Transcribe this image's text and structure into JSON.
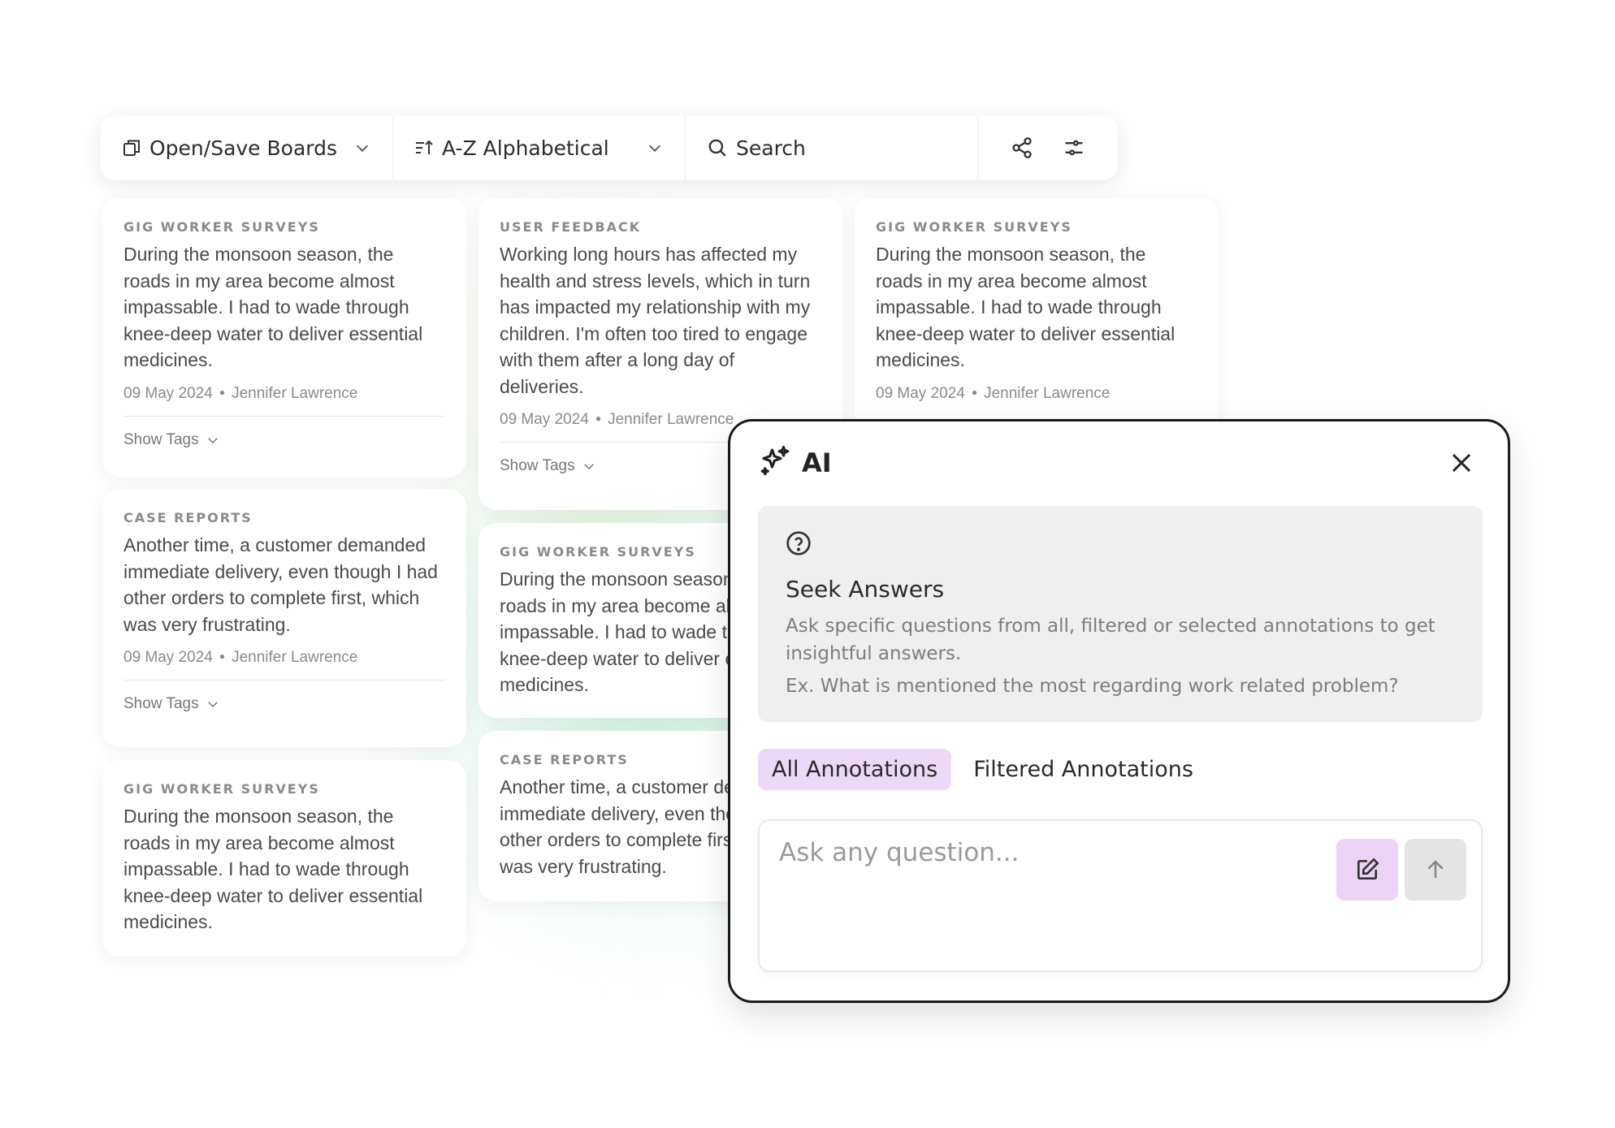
{
  "toolbar": {
    "boards_label": "Open/Save Boards",
    "sort_label": "A-Z Alphabetical",
    "search_label": "Search"
  },
  "cards": [
    {
      "category": "GIG WORKER SURVEYS",
      "text": "During the monsoon season, the roads in my area become almost impassable. I had to wade through knee-deep water to deliver essential medicines.",
      "date": "09 May 2024",
      "author": "Jennifer Lawrence",
      "tags_label": "Show Tags"
    },
    {
      "category": "CASE REPORTS",
      "text": "Another time, a customer demanded immediate delivery, even though I had other orders to complete first, which was very frustrating.",
      "date": "09 May 2024",
      "author": "Jennifer Lawrence",
      "tags_label": "Show Tags"
    },
    {
      "category": "GIG WORKER SURVEYS",
      "text": "During the monsoon season, the roads in my area become almost impassable. I had to wade through knee-deep water to deliver essential medicines."
    },
    {
      "category": "USER FEEDBACK",
      "text": "Working long hours has affected my health and stress levels, which in turn has impacted my relationship with my children. I'm often too tired to engage with them after a long day of deliveries.",
      "date": "09 May 2024",
      "author": "Jennifer Lawrence",
      "tags_label": "Show Tags"
    },
    {
      "category": "GIG WORKER SURVEYS",
      "text": "During the monsoon season, the roads in my area become almost impassable. I had to wade through knee-deep water to deliver essential medicines."
    },
    {
      "category": "CASE REPORTS",
      "text": "Another time, a customer demanded immediate delivery, even though I had other orders to complete first, which was very frustrating."
    },
    {
      "category": "GIG WORKER SURVEYS",
      "text": "During the monsoon season, the roads in my area become almost impassable. I had to wade through knee-deep water to deliver essential medicines.",
      "date": "09 May 2024",
      "author": "Jennifer Lawrence"
    }
  ],
  "ai_panel": {
    "title": "AI",
    "seek_title": "Seek Answers",
    "seek_description": "Ask specific questions from all, filtered or selected annotations to get insightful answers.",
    "seek_example": "Ex. What is mentioned the most regarding work related problem?",
    "tabs": [
      {
        "label": "All Annotations",
        "active": true
      },
      {
        "label": "Filtered Annotations",
        "active": false
      }
    ],
    "input_placeholder": "Ask any question..."
  },
  "colors": {
    "active_tab_bg": "#ecd9f7",
    "edit_button_bg": "#ecd3f5",
    "send_button_bg": "#e4e4e4",
    "glow": "#78d7aa"
  }
}
